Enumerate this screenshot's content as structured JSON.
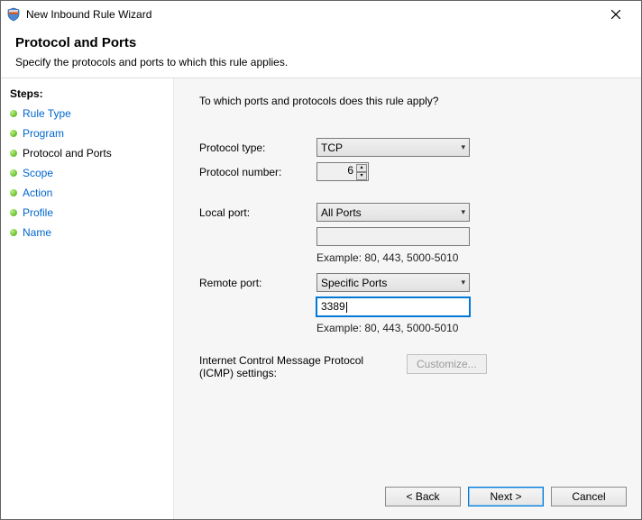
{
  "titlebar": {
    "title": "New Inbound Rule Wizard"
  },
  "header": {
    "title": "Protocol and Ports",
    "subtitle": "Specify the protocols and ports to which this rule applies."
  },
  "sidebar": {
    "heading": "Steps:",
    "items": [
      {
        "label": "Rule Type"
      },
      {
        "label": "Program"
      },
      {
        "label": "Protocol and Ports"
      },
      {
        "label": "Scope"
      },
      {
        "label": "Action"
      },
      {
        "label": "Profile"
      },
      {
        "label": "Name"
      }
    ]
  },
  "content": {
    "prompt": "To which ports and protocols does this rule apply?",
    "protocol_type_label": "Protocol type:",
    "protocol_type_value": "TCP",
    "protocol_number_label": "Protocol number:",
    "protocol_number_value": "6",
    "local_port_label": "Local port:",
    "local_port_value": "All Ports",
    "local_port_text": "",
    "local_port_example": "Example: 80, 443, 5000-5010",
    "remote_port_label": "Remote port:",
    "remote_port_value": "Specific Ports",
    "remote_port_text": "3389",
    "remote_port_example": "Example: 80, 443, 5000-5010",
    "icmp_label": "Internet Control Message Protocol (ICMP) settings:",
    "customize_label": "Customize..."
  },
  "footer": {
    "back": "< Back",
    "next": "Next >",
    "cancel": "Cancel"
  }
}
